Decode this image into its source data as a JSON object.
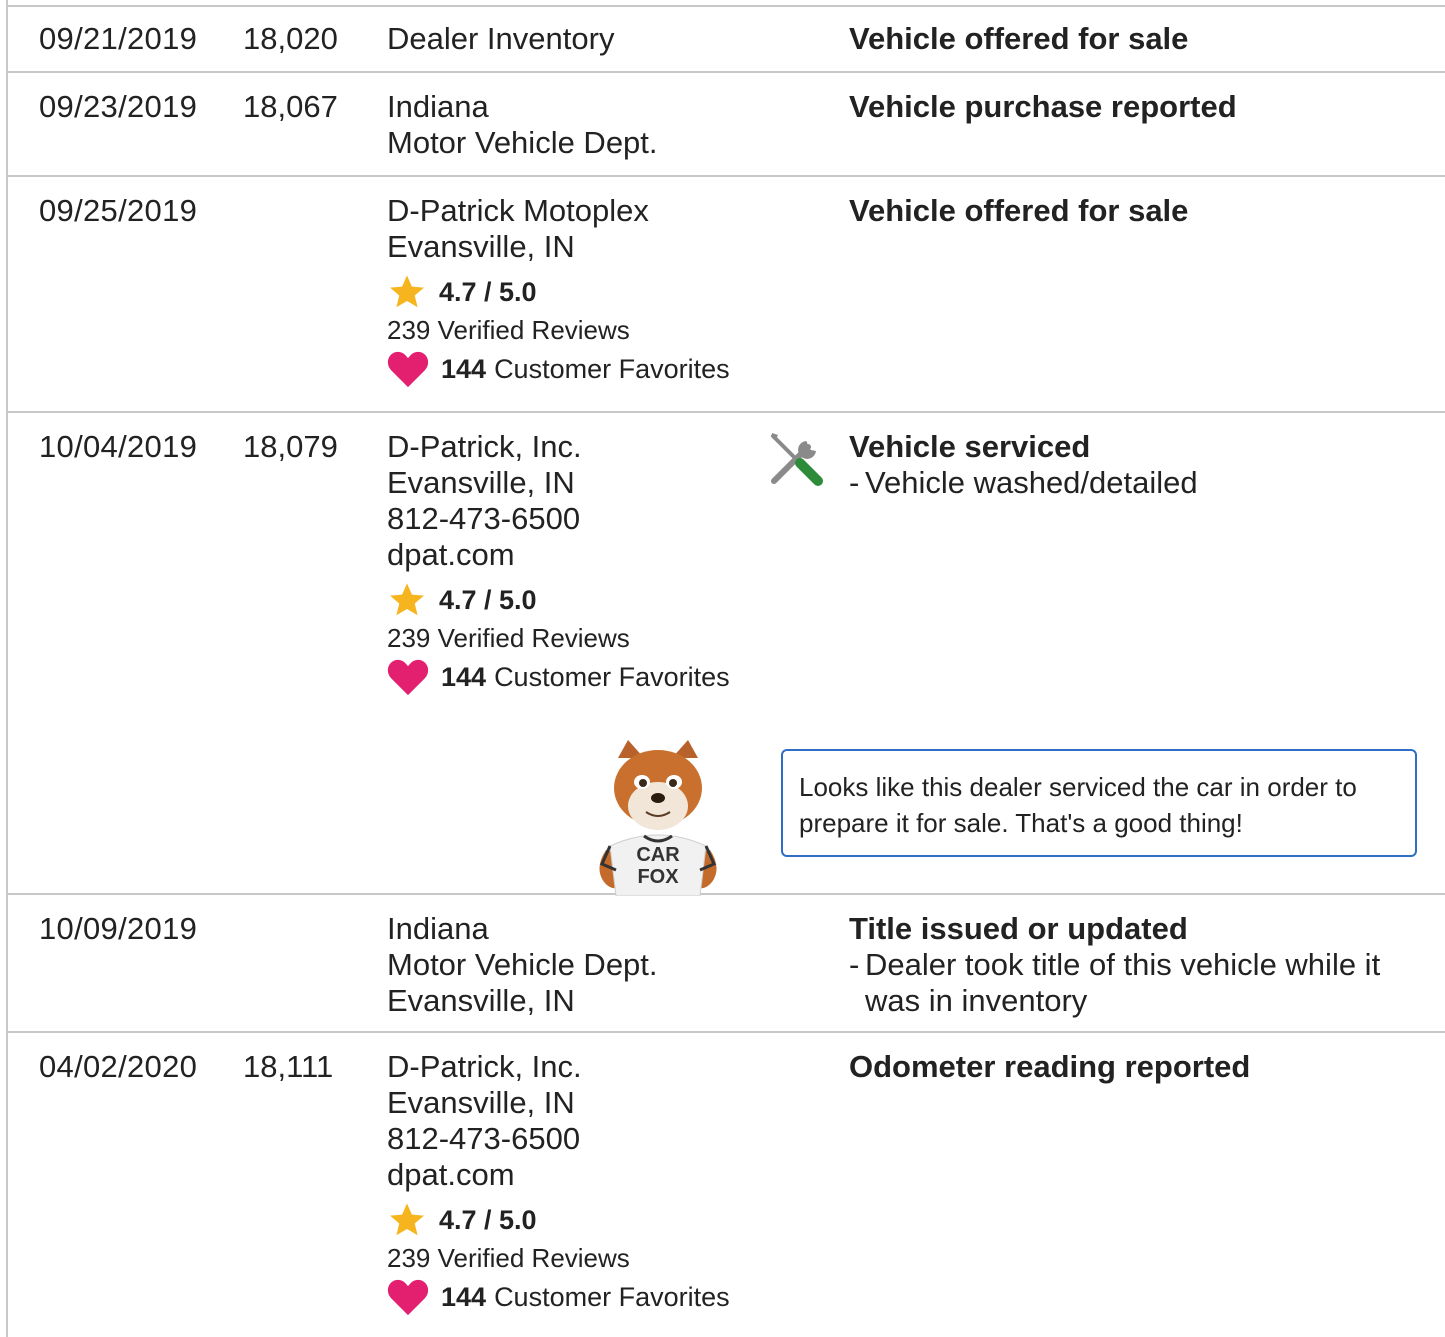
{
  "colors": {
    "border": "#c8c8c8",
    "star": "#f6b51e",
    "heart": "#e2206f",
    "callout_border": "#2e6ec6",
    "wrench_green": "#2e8b3a",
    "tool_gray": "#8a8a8a"
  },
  "records": [
    {
      "date": "09/21/2019",
      "mileage": "18,020",
      "source_lines": [
        "Dealer Inventory"
      ],
      "title": "Vehicle offered for sale"
    },
    {
      "date": "09/23/2019",
      "mileage": "18,067",
      "source_lines": [
        "Indiana",
        "Motor Vehicle Dept."
      ],
      "title": "Vehicle purchase reported"
    },
    {
      "date": "09/25/2019",
      "mileage": "",
      "source_lines": [
        "D-Patrick Motoplex",
        "Evansville, IN"
      ],
      "rating": "4.7 / 5.0",
      "reviews": "239 Verified Reviews",
      "favorites_count": "144",
      "favorites_label": "Customer Favorites",
      "title": "Vehicle offered for sale"
    },
    {
      "date": "10/04/2019",
      "mileage": "18,079",
      "source_lines": [
        "D-Patrick, Inc.",
        "Evansville, IN",
        "812-473-6500",
        "dpat.com"
      ],
      "rating": "4.7 / 5.0",
      "reviews": "239 Verified Reviews",
      "favorites_count": "144",
      "favorites_label": "Customer Favorites",
      "icon": "wrench-screwdriver-icon",
      "title": "Vehicle serviced",
      "details": [
        "Vehicle washed/detailed"
      ],
      "callout": "Looks like this dealer serviced the car in order to prepare it for sale. That's a good thing!",
      "mascot_shirt": [
        "CAR",
        "FOX"
      ]
    },
    {
      "date": "10/09/2019",
      "mileage": "",
      "source_lines": [
        "Indiana",
        "Motor Vehicle Dept.",
        "Evansville, IN"
      ],
      "title": "Title issued or updated",
      "details": [
        "Dealer took title of this vehicle while it was in inventory"
      ]
    },
    {
      "date": "04/02/2020",
      "mileage": "18,111",
      "source_lines": [
        "D-Patrick, Inc.",
        "Evansville, IN",
        "812-473-6500",
        "dpat.com"
      ],
      "rating": "4.7 / 5.0",
      "reviews": "239 Verified Reviews",
      "favorites_count": "144",
      "favorites_label": "Customer Favorites",
      "title": "Odometer reading reported"
    }
  ]
}
